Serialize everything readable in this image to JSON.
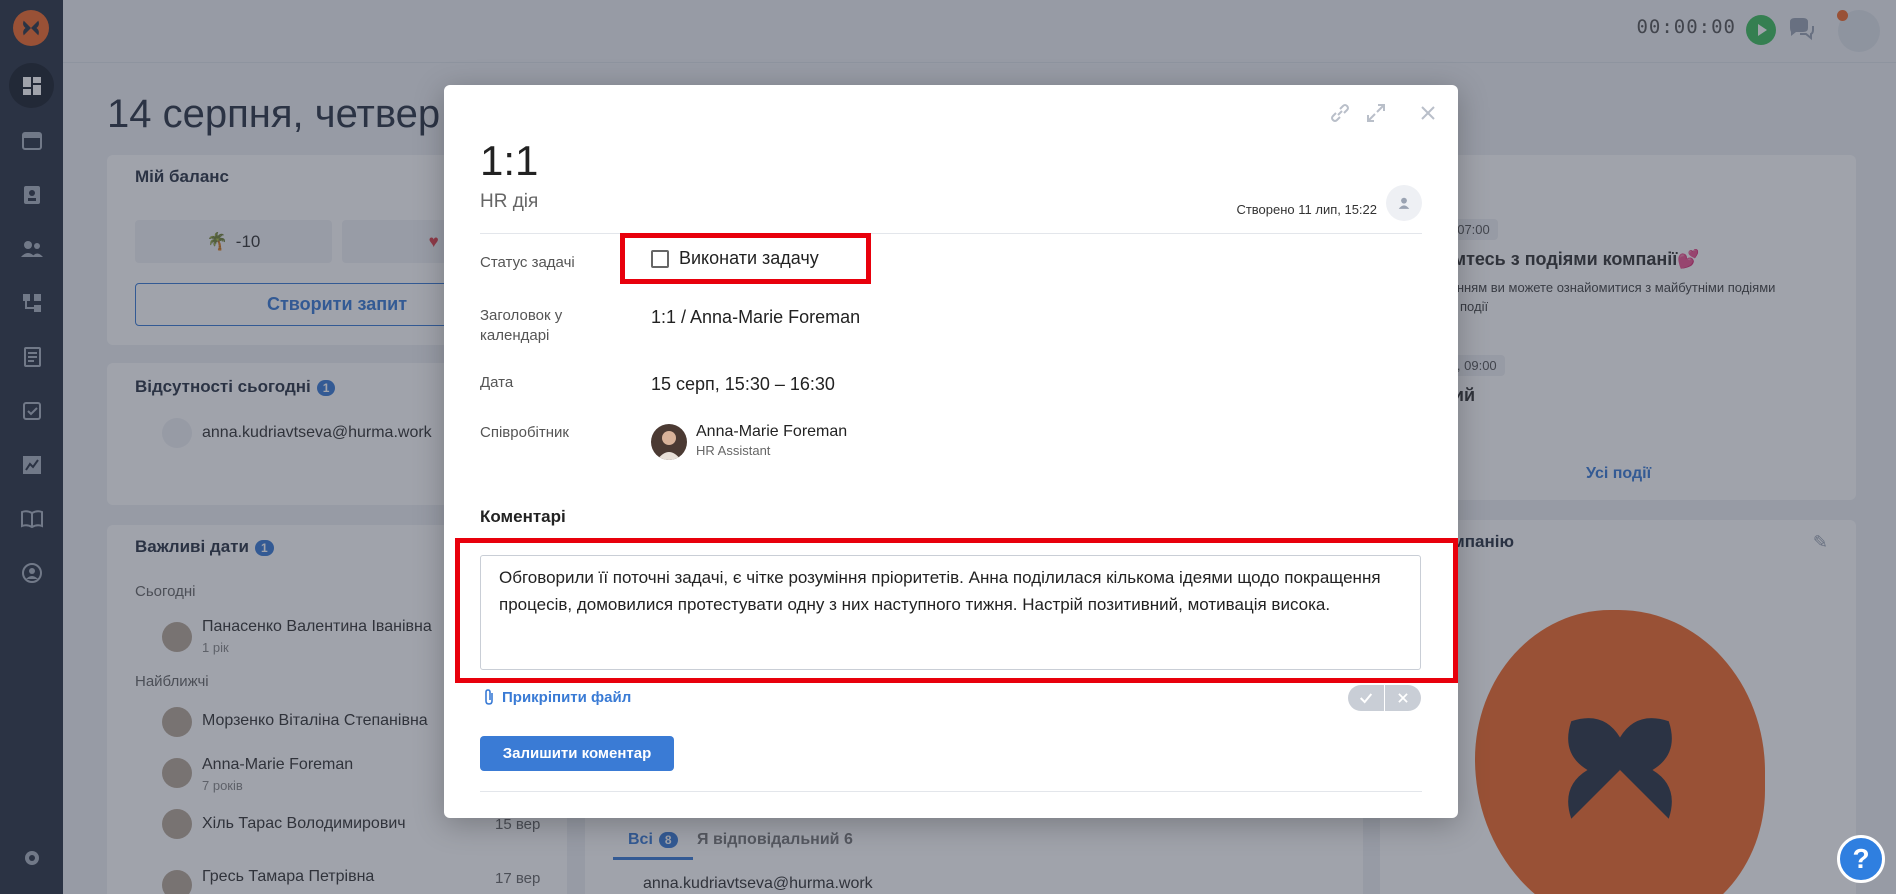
{
  "topbar": {
    "timer": "00:00:00"
  },
  "dashboard": {
    "date_heading": "14 серпня, четвер",
    "balance": {
      "title": "Мій баланс",
      "vacation": "-10",
      "sick": "-",
      "create_request": "Створити запит"
    },
    "absences": {
      "title": "Відсутності сьогодні",
      "count": "1",
      "person": "anna.kudriavtseva@hurma.work"
    },
    "important_dates": {
      "title": "Важливі дати",
      "count": "1",
      "today_label": "Сьогодні",
      "upcoming_label": "Найближчі",
      "items": [
        {
          "name": "Панасенко Валентина Іванівна",
          "sub": "1 рік",
          "date": ""
        },
        {
          "name": "Морзенко Віталіна Степанівна",
          "sub": "",
          "date": ""
        },
        {
          "name": "Anna-Marie Foreman",
          "sub": "7 років",
          "date": ""
        },
        {
          "name": "Хіль Тарас Володимирович",
          "sub": "",
          "date": "15 вер"
        },
        {
          "name": "Гресь Тамара Петрівна",
          "sub": "",
          "date": "17 вер"
        }
      ]
    },
    "events": {
      "ev1_time": ", 07:00",
      "ev1_title": "омтесь з подіями компанії💕",
      "ev1_desc1": "ланням ви можете ознайомитися з майбутніми подіями",
      "ev1_desc2": "на події",
      "ev2_time": "в, 09:00",
      "ev2_title": "ний",
      "all_events": "Усі події"
    },
    "company": {
      "title": "омпанію"
    },
    "tasks_tabs": {
      "all": "Всі",
      "all_count": "8",
      "responsible": "Я відповідальний",
      "responsible_count": "6",
      "row": "anna.kudriavtseva@hurma.work"
    }
  },
  "modal": {
    "title": "1:1",
    "subtitle": "HR дія",
    "created": "Створено 11 лип, 15:22",
    "fields": {
      "status_label": "Статус задачі",
      "status_action": "Виконати задачу",
      "calendar_label": "Заголовок у календарі",
      "calendar_value": "1:1 / Anna-Marie Foreman",
      "date_label": "Дата",
      "date_value": "15 серп, 15:30 – 16:30",
      "employee_label": "Співробітник",
      "employee_name": "Anna-Marie Foreman",
      "employee_role": "HR Assistant"
    },
    "comments_title": "Коментарі",
    "comment_text": "Обговорили її поточні задачі, є чітке розуміння пріоритетів. Анна поділилася кількома ідеями щодо покращення процесів, домовилися протестувати одну з них наступного тижня. Настрій позитивний, мотивація висока.",
    "attach_label": "Прикріпити файл",
    "submit_label": "Залишити коментар"
  },
  "help": "?"
}
